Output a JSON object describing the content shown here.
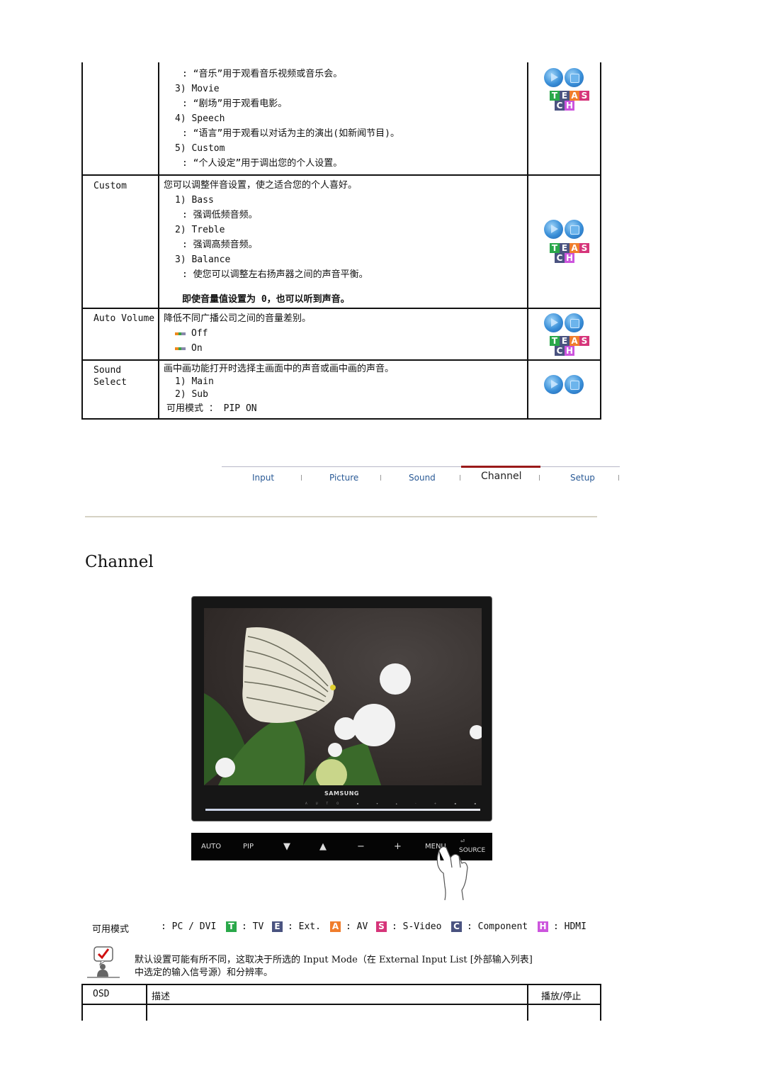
{
  "sound_table": {
    "rows": [
      {
        "name": "",
        "lines": [
          ": “音乐”用于观看音乐视频或音乐会。",
          "3) Movie",
          ": “剧场”用于观看电影。",
          "4) Speech",
          ": “语言”用于观看以对话为主的演出(如新闻节目)。",
          "5) Custom",
          ": “个人设定”用于调出您的个人设置。"
        ],
        "icons": [
          "play-icon",
          "stop-icon",
          "mode-badges-teasch"
        ]
      },
      {
        "name": "Custom",
        "lines": [
          "您可以调整伴音设置，使之适合您的个人喜好。",
          "1) Bass",
          ": 强调低频音频。",
          "2) Treble",
          ": 强调高频音频。",
          "3) Balance",
          ": 使您可以调整左右扬声器之间的声音平衡。"
        ],
        "note": "即使音量值设置为 0，也可以听到声音。",
        "icons": [
          "play-icon",
          "stop-icon",
          "mode-badges-teasch"
        ]
      },
      {
        "name": "Auto Volume",
        "lines": [
          "降低不同广播公司之间的音量差别。"
        ],
        "options": [
          "Off",
          "On"
        ],
        "icons": [
          "play-icon",
          "stop-icon",
          "mode-badges-teasch"
        ]
      },
      {
        "name_lines": [
          "Sound",
          "Select"
        ],
        "lines": [
          "画中画功能打开时选择主画面中的声音或画中画的声音。",
          "1) Main",
          "2) Sub"
        ],
        "available": "可用模式 ： PIP ON",
        "icons": [
          "play-icon",
          "stop-icon"
        ]
      }
    ],
    "badges": {
      "row1": [
        "T",
        "E",
        "A",
        "S"
      ],
      "row2": [
        "C",
        "H"
      ]
    }
  },
  "nav": {
    "tabs": [
      {
        "label": "Input"
      },
      {
        "label": "Picture"
      },
      {
        "label": "Sound"
      },
      {
        "label": "Channel",
        "active": true
      },
      {
        "label": "Setup"
      }
    ],
    "accent": "#9a1a1a"
  },
  "section_title": "Channel",
  "monitor": {
    "brand": "SAMSUNG",
    "tiny_buttons": "AUTO ▪ ▾ ▴ - + ▪ ▪",
    "control_bar": [
      "AUTO",
      "PIP",
      "▼",
      "▲",
      "−",
      "+",
      "MENU",
      "SOURCE"
    ]
  },
  "modes": {
    "label": "可用模式",
    "items": [
      {
        "badge": "",
        "text": ": PC / DVI"
      },
      {
        "badge": "T",
        "text": ": TV",
        "color": "#2aa84a"
      },
      {
        "badge": "E",
        "text": ": Ext.",
        "color": "#4a5380"
      },
      {
        "badge": "A",
        "text": ": AV",
        "color": "#f07d2c"
      },
      {
        "badge": "S",
        "text": ": S-Video",
        "color": "#d6357a"
      },
      {
        "badge": "C",
        "text": ": Component",
        "color": "#4a5380"
      },
      {
        "badge": "H",
        "text": ": HDMI",
        "color": "#cc55dd"
      }
    ]
  },
  "note": {
    "line1": "默认设置可能有所不同，这取决于所选的 Input Mode（在 External Input List [外部输入列表]",
    "line2": "中选定的输入信号源）和分辨率。"
  },
  "osd_table": {
    "headers": [
      "OSD",
      "描述",
      "播放/停止"
    ]
  }
}
